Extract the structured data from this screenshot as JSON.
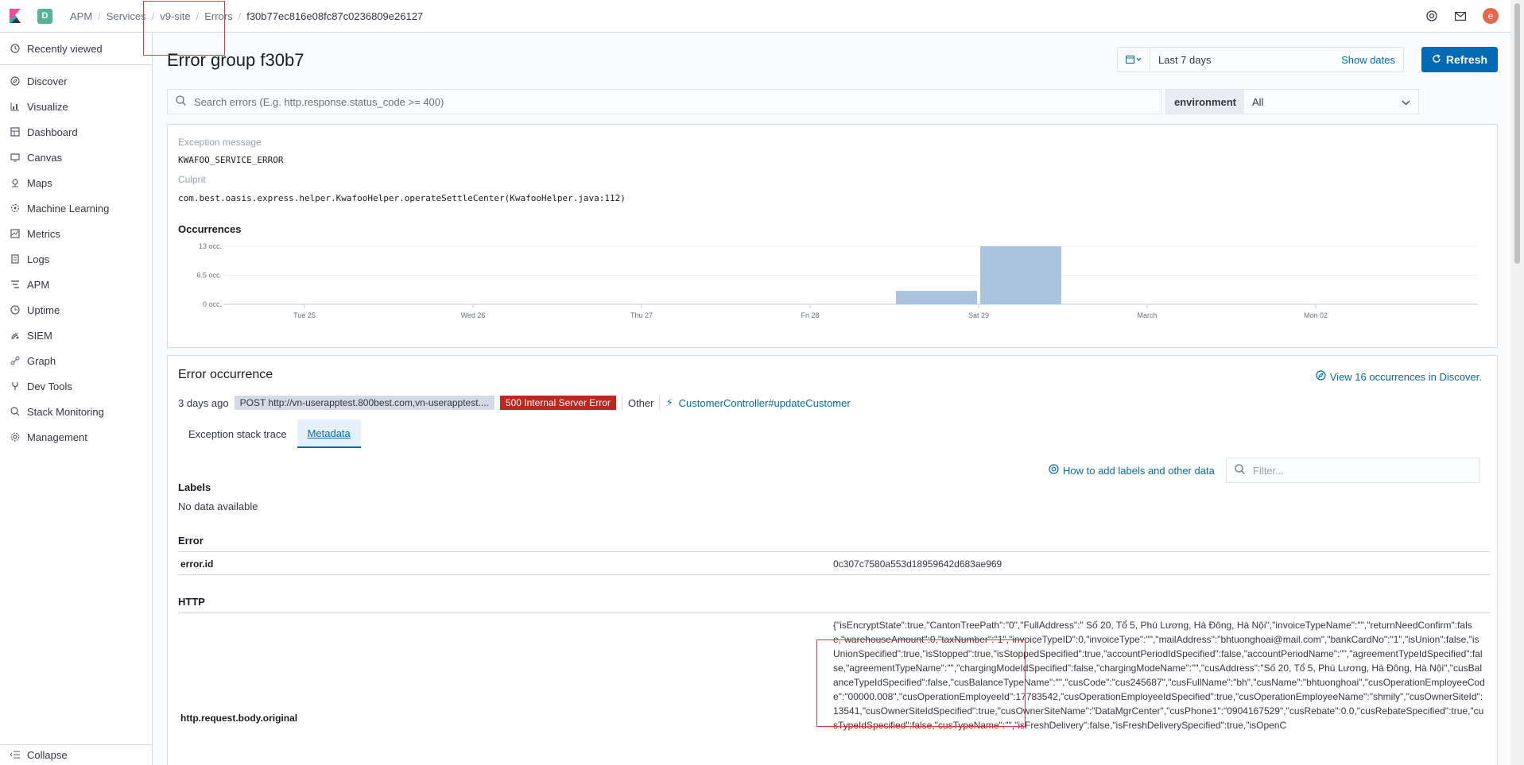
{
  "header": {
    "space_initial": "D",
    "breadcrumbs": [
      "APM",
      "Services",
      "v9-site",
      "Errors",
      "f30b77ec816e08fc87c0236809e26127"
    ],
    "avatar_initial": "e"
  },
  "sidebar": {
    "recently_viewed": "Recently viewed",
    "items": [
      {
        "label": "Discover",
        "icon": "compass-icon"
      },
      {
        "label": "Visualize",
        "icon": "visualize-icon"
      },
      {
        "label": "Dashboard",
        "icon": "dashboard-icon"
      },
      {
        "label": "Canvas",
        "icon": "canvas-icon"
      },
      {
        "label": "Maps",
        "icon": "maps-icon"
      },
      {
        "label": "Machine Learning",
        "icon": "ml-icon"
      },
      {
        "label": "Metrics",
        "icon": "metrics-icon"
      },
      {
        "label": "Logs",
        "icon": "logs-icon"
      },
      {
        "label": "APM",
        "icon": "apm-icon"
      },
      {
        "label": "Uptime",
        "icon": "uptime-icon"
      },
      {
        "label": "SIEM",
        "icon": "siem-icon"
      },
      {
        "label": "Graph",
        "icon": "graph-icon"
      },
      {
        "label": "Dev Tools",
        "icon": "devtools-icon"
      },
      {
        "label": "Stack Monitoring",
        "icon": "monitoring-icon"
      },
      {
        "label": "Management",
        "icon": "gear-icon"
      }
    ],
    "collapse": "Collapse"
  },
  "page": {
    "title": "Error group f30b7",
    "date_range": "Last 7 days",
    "show_dates": "Show dates",
    "refresh": "Refresh",
    "search_placeholder": "Search errors (E.g. http.response.status_code >= 400)",
    "environment_label": "environment",
    "environment_value": "All"
  },
  "summary": {
    "exception_label": "Exception message",
    "exception_value": "KWAFOO_SERVICE_ERROR",
    "culprit_label": "Culprit",
    "culprit_value": "com.best.oasis.express.helper.KwafooHelper.operateSettleCenter(KwafooHelper.java:112)",
    "occurrences_title": "Occurrences"
  },
  "chart_data": {
    "type": "bar",
    "title": "Occurrences",
    "y_ticks": [
      "13 occ.",
      "6.5 occ.",
      "0 occ."
    ],
    "ylim": [
      0,
      13
    ],
    "x_ticks": [
      "Tue 25",
      "Wed 26",
      "Thu 27",
      "Fri 28",
      "Sat 29",
      "March",
      "Mon 02"
    ],
    "bars": [
      {
        "x_start": "Fri 28 12:00",
        "x_end": "Sat 29 00:00",
        "value": 3
      },
      {
        "x_start": "Sat 29 00:00",
        "x_end": "Sat 29 12:00",
        "value": 13
      }
    ],
    "bar_color": "#aac4df",
    "grid": true
  },
  "occurrence": {
    "title": "Error occurrence",
    "discover_link": "View 16 occurrences in Discover.",
    "time": "3 days ago",
    "request": "POST http://vn-userapptest.800best.com,vn-userapptest....",
    "status": "500 Internal Server Error",
    "other": "Other",
    "transaction": "CustomerController#updateCustomer",
    "tabs": [
      "Exception stack trace",
      "Metadata"
    ],
    "active_tab": "Metadata",
    "help_link": "How to add labels and other data",
    "filter_placeholder": "Filter...",
    "labels_heading": "Labels",
    "labels_empty": "No data available",
    "error_heading": "Error",
    "error_id_key": "error.id",
    "error_id_value": "0c307c7580a553d18959642d683ae969",
    "http_heading": "HTTP",
    "http_body_key": "http.request.body.original",
    "http_body_value": "{\"isEncryptState\":true,\"CantonTreePath\":\"0\",\"FullAddress\":\" Số 20, Tổ 5, Phú Lương, Hà Đông, Hà Nội\",\"invoiceTypeName\":\"\",\"returnNeedConfirm\":false,\"warehouseAmount\":0,\"taxNumber\":\"1\",\"invoiceTypeID\":0,\"invoiceType\":\"\",\"mailAddress\":\"bhtuonghoai@mail.com\",\"bankCardNo\":\"1\",\"isUnion\":false,\"isUnionSpecified\":true,\"isStopped\":true,\"isStoppedSpecified\":true,\"accountPeriodIdSpecified\":false,\"accountPeriodName\":\"\",\"agreementTypeIdSpecified\":false,\"agreementTypeName\":\"\",\"chargingModeIdSpecified\":false,\"chargingModeName\":\"\",\"cusAddress\":\"Số 20, Tổ 5, Phú Lương, Hà Đông, Hà Nội\",\"cusBalanceTypeIdSpecified\":false,\"cusBalanceTypeName\":\"\",\"cusCode\":\"cus245687\",\"cusFullName\":\"bh\",\"cusName\":\"bhtuonghoai\",\"cusOperationEmployeeCode\":\"00000.008\",\"cusOperationEmployeeId\":17783542,\"cusOperationEmployeeIdSpecified\":true,\"cusOperationEmployeeName\":\"shmily\",\"cusOwnerSiteId\":13541,\"cusOwnerSiteIdSpecified\":true,\"cusOwnerSiteName\":\"DataMgrCenter\",\"cusPhone1\":\"0904167529\",\"cusRebate\":0.0,\"cusRebateSpecified\":true,\"cusTypeIdSpecified\":false,\"cusTypeName\":\"\",\"isFreshDelivery\":false,\"isFreshDeliverySpecified\":true,\"isOpenC"
  }
}
